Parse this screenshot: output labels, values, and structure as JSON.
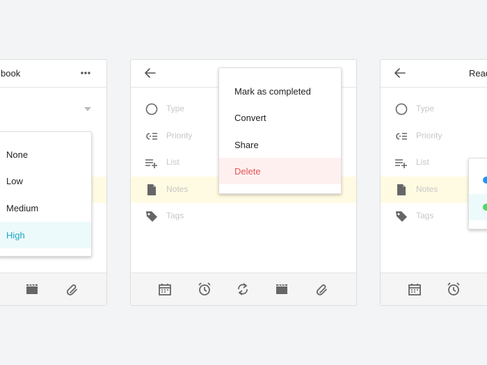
{
  "left_panel": {
    "title": "book",
    "priority_options": [
      {
        "label": "None"
      },
      {
        "label": "Low"
      },
      {
        "label": "Medium"
      },
      {
        "label": "High"
      }
    ],
    "selected_option": "High"
  },
  "center_panel": {
    "fields": [
      {
        "label": "Type"
      },
      {
        "label": "Priority"
      },
      {
        "label": "List"
      },
      {
        "label": "Notes"
      },
      {
        "label": "Tags"
      }
    ],
    "menu": [
      {
        "label": "Mark as completed"
      },
      {
        "label": "Convert"
      },
      {
        "label": "Share"
      },
      {
        "label": "Delete"
      }
    ]
  },
  "right_panel": {
    "title": "Read",
    "fields": [
      {
        "label": "Type"
      },
      {
        "label": "Priority"
      },
      {
        "label": "List"
      },
      {
        "label": "Notes"
      },
      {
        "label": "Tags"
      }
    ]
  },
  "colors": {
    "accent": "#1aa9c3",
    "danger": "#e55454",
    "highlight_row": "#fffbe3",
    "list_dot_blue": "#2196f3",
    "list_dot_green": "#4cd964"
  }
}
